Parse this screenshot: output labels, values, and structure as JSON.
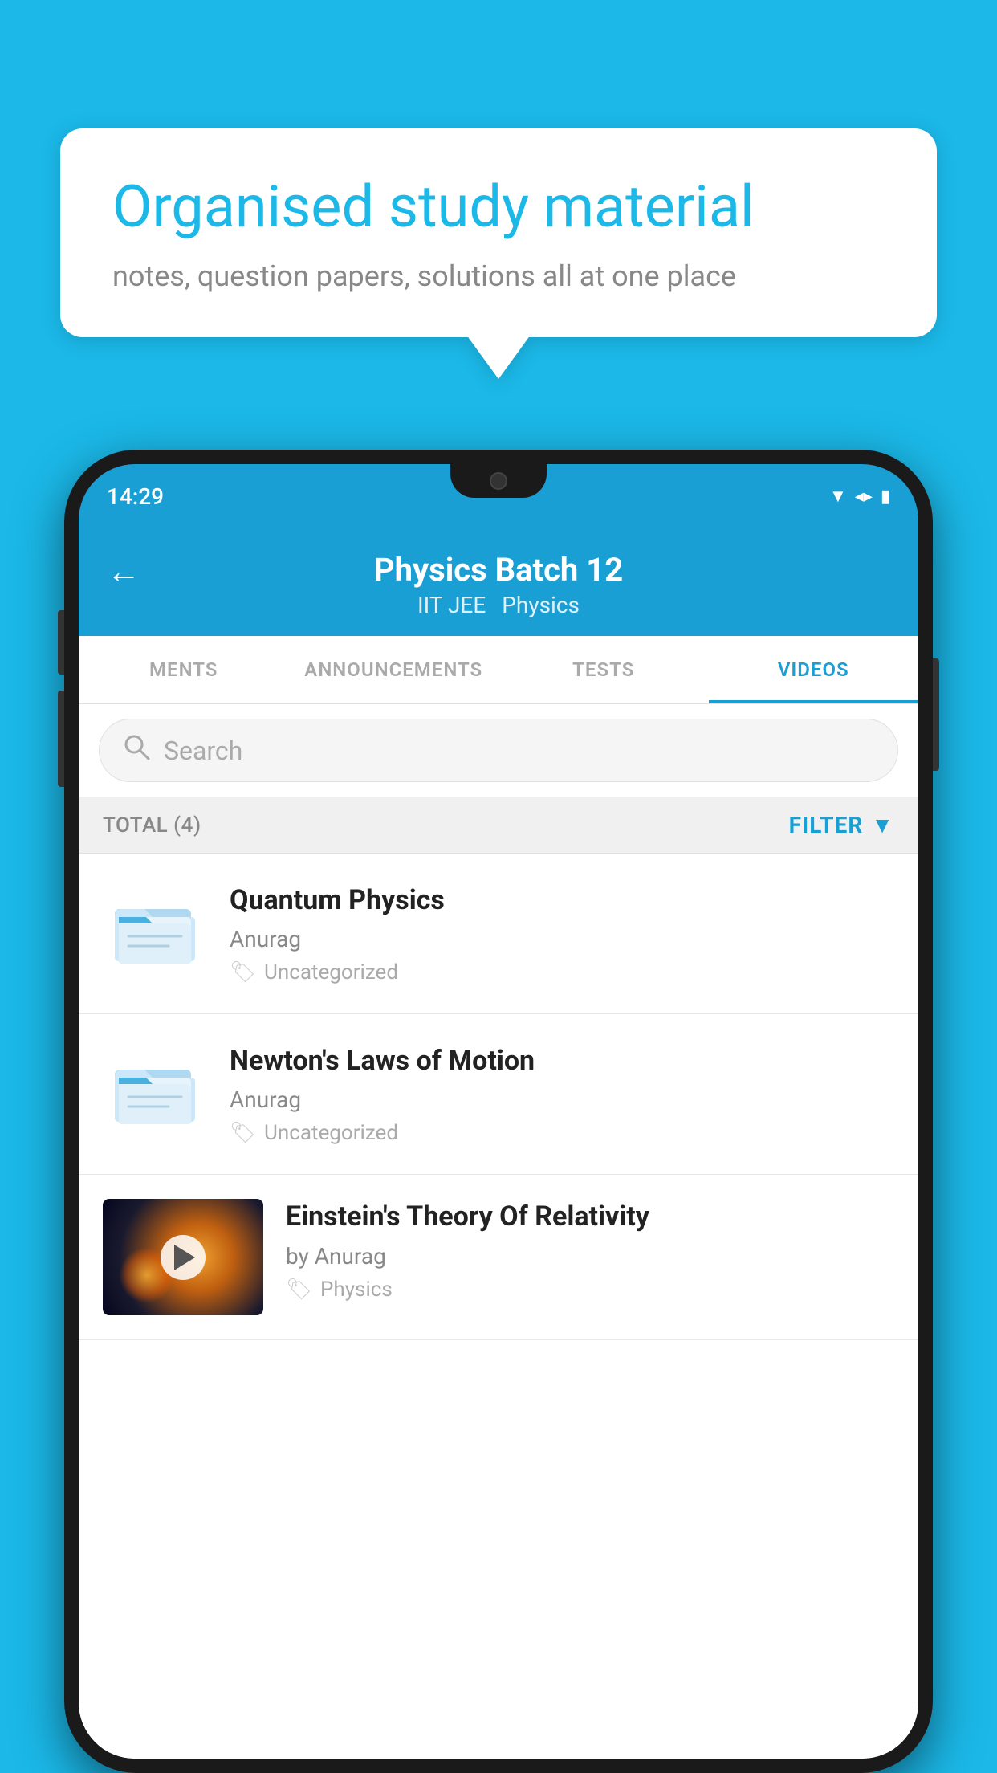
{
  "background_color": "#1BB8E8",
  "bubble": {
    "title": "Organised study material",
    "subtitle": "notes, question papers, solutions all at one place"
  },
  "phone": {
    "status_bar": {
      "time": "14:29"
    },
    "header": {
      "title": "Physics Batch 12",
      "subtitle1": "IIT JEE",
      "subtitle2": "Physics",
      "back_label": "←"
    },
    "tabs": [
      {
        "label": "MENTS",
        "active": false
      },
      {
        "label": "ANNOUNCEMENTS",
        "active": false
      },
      {
        "label": "TESTS",
        "active": false
      },
      {
        "label": "VIDEOS",
        "active": true
      }
    ],
    "search": {
      "placeholder": "Search"
    },
    "filter_row": {
      "total": "TOTAL (4)",
      "filter_label": "FILTER"
    },
    "videos": [
      {
        "title": "Quantum Physics",
        "author": "Anurag",
        "tag": "Uncategorized",
        "type": "folder"
      },
      {
        "title": "Newton's Laws of Motion",
        "author": "Anurag",
        "tag": "Uncategorized",
        "type": "folder"
      },
      {
        "title": "Einstein's Theory Of Relativity",
        "author": "by Anurag",
        "tag": "Physics",
        "type": "video"
      }
    ]
  }
}
